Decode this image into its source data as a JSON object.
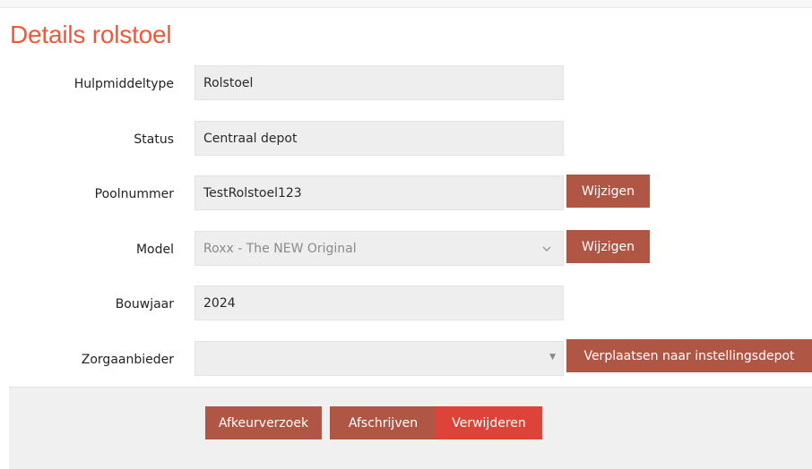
{
  "page": {
    "title": "Details rolstoel"
  },
  "fields": {
    "hulpmiddeltype": {
      "label": "Hulpmiddeltype",
      "value": "Rolstoel"
    },
    "status": {
      "label": "Status",
      "value": "Centraal depot"
    },
    "poolnummer": {
      "label": "Poolnummer",
      "value": "TestRolstoel123"
    },
    "model": {
      "label": "Model",
      "value": "Roxx - The NEW Original"
    },
    "bouwjaar": {
      "label": "Bouwjaar",
      "value": "2024"
    },
    "zorgaanbieder": {
      "label": "Zorgaanbieder",
      "value": ""
    }
  },
  "buttons": {
    "poolnummer_change": "Wijzigen",
    "model_change": "Wijzigen",
    "move_to_depot": "Verplaatsen naar instellingsdepot",
    "reject_request": "Afkeurverzoek",
    "write_off": "Afschrijven",
    "delete": "Verwijderen"
  },
  "icons": {
    "model_dropdown": "chevron-down-icon",
    "zorgaanbieder_dropdown": "caret-down-icon"
  },
  "colors": {
    "title": "#f0583a",
    "button_primary": "#b05645",
    "button_danger": "#de4339",
    "field_background": "#eeeeee",
    "footer_background": "#f0f0f0"
  }
}
